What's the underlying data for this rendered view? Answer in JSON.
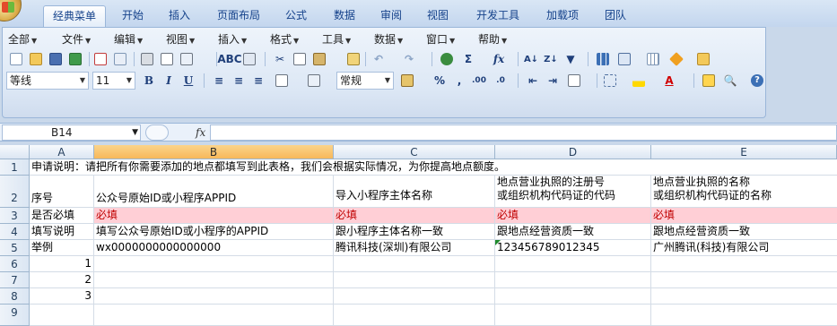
{
  "tabs": [
    "经典菜单",
    "开始",
    "插入",
    "页面布局",
    "公式",
    "数据",
    "审阅",
    "视图",
    "开发工具",
    "加载项",
    "团队"
  ],
  "menus": [
    "全部",
    "文件",
    "编辑",
    "视图",
    "插入",
    "格式",
    "工具",
    "数据",
    "窗口",
    "帮助"
  ],
  "toolbar": {
    "font_name": "等线",
    "font_size": "11",
    "bold": "B",
    "italic": "I",
    "underline": "U",
    "number_format": "常规",
    "percent": "%",
    "comma": ",",
    "dec_inc": ".00",
    "dec_dec": ".0"
  },
  "formula_bar": {
    "name_box": "B14",
    "fx": "fx",
    "value": ""
  },
  "columns": [
    "A",
    "B",
    "C",
    "D",
    "E"
  ],
  "rows": [
    "1",
    "2",
    "3",
    "4",
    "5",
    "6",
    "7",
    "8",
    "9"
  ],
  "sheet": {
    "r1": {
      "A": "申请说明：请把所有你需要添加的地点都填写到此表格，我们会根据实际情况，为你提高地点额度。"
    },
    "r2": {
      "A": "序号",
      "B": "公众号原始ID或小程序APPID",
      "C": "导入小程序主体名称",
      "D": "地点营业执照的注册号或组织机构代码证的代码",
      "D1": "地点营业执照的注册号",
      "D2": "或组织机构代码证的代码",
      "E1": "地点营业执照的名称",
      "E2": "或组织机构代码证的名称"
    },
    "r3": {
      "A": "是否必填",
      "B": "必填",
      "C": "必填",
      "D": "必填",
      "E": "必填"
    },
    "r4": {
      "A": "填写说明",
      "B": "填写公众号原始ID或小程序的APPID",
      "C": "跟小程序主体名称一致",
      "D": "跟地点经营资质一致",
      "E": "跟地点经营资质一致"
    },
    "r5": {
      "A": "举例",
      "B": "wx0000000000000000",
      "C": "腾讯科技(深圳)有限公司",
      "D": "123456789012345",
      "E": "广州腾讯(科技)有限公司"
    },
    "r6": {
      "A": "1"
    },
    "r7": {
      "A": "2"
    },
    "r8": {
      "A": "3"
    }
  },
  "colors": {
    "required_fill": "#ffcfd6",
    "required_text": "#c00000",
    "selected_header": "#f7b85a"
  }
}
